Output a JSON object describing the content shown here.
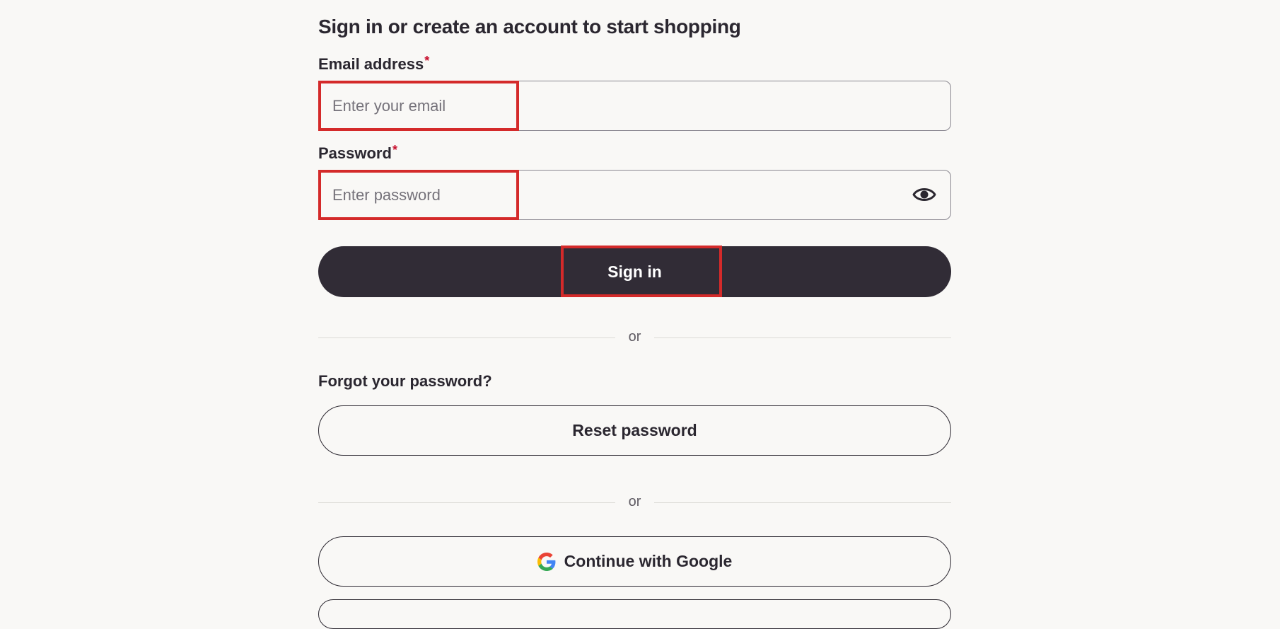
{
  "form": {
    "heading": "Sign in or create an account to start shopping",
    "email": {
      "label": "Email address",
      "required_mark": "*",
      "placeholder": "Enter your email",
      "value": ""
    },
    "password": {
      "label": "Password",
      "required_mark": "*",
      "placeholder": "Enter password",
      "value": ""
    },
    "sign_in_label": "Sign in",
    "divider_text": "or",
    "forgot_text": "Forgot your password?",
    "reset_label": "Reset password",
    "divider2_text": "or",
    "google_label": "Continue with Google"
  },
  "icons": {
    "password_toggle": "eye-icon",
    "google": "google-logo-icon"
  },
  "colors": {
    "background": "#f9f8f6",
    "primary_button": "#312c36",
    "required_mark": "#c8102e",
    "highlight": "#d42a2a"
  }
}
